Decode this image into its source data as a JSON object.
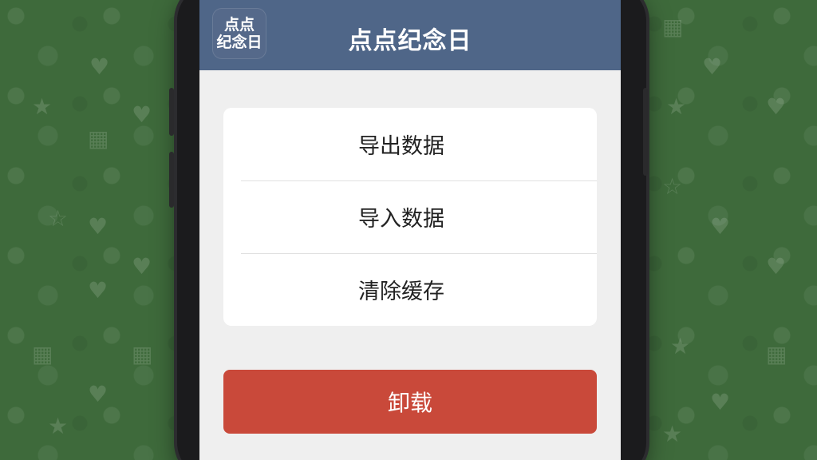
{
  "app": {
    "icon_text_line1": "点点",
    "icon_text_line2": "纪念日",
    "title": "点点纪念日"
  },
  "menu": {
    "items": [
      {
        "label": "导出数据"
      },
      {
        "label": "导入数据"
      },
      {
        "label": "清除缓存"
      }
    ]
  },
  "actions": {
    "uninstall_label": "卸载"
  },
  "colors": {
    "header": "#4f6688",
    "danger": "#c9493a",
    "background": "#3e6a3b"
  },
  "icons": {
    "background_pattern": "doodle-icons"
  }
}
